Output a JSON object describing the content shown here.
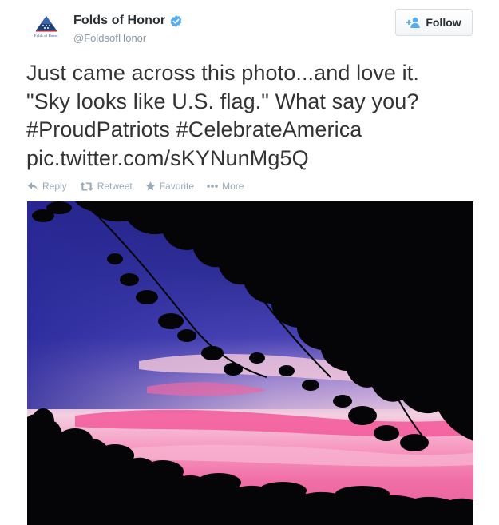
{
  "user": {
    "display_name": "Folds of Honor",
    "handle": "@FoldsofHonor",
    "avatar_text": "Folds of Honor",
    "verified": true
  },
  "follow_button": {
    "label": "Follow",
    "icon": "add-user-icon"
  },
  "tweet": {
    "lines": [
      "Just came across this photo...and love it.",
      "\"Sky looks like U.S. flag.\" What say you?",
      "#ProudPatriots #CelebrateAmerica",
      "pic.twitter.com/sKYNunMg5Q"
    ]
  },
  "actions": [
    {
      "label": "Reply",
      "icon": "reply-icon"
    },
    {
      "label": "Retweet",
      "icon": "retweet-icon"
    },
    {
      "label": "Favorite",
      "icon": "star-icon"
    },
    {
      "label": "More",
      "icon": "more-icon"
    }
  ],
  "colors": {
    "verified": "#55acee",
    "follow_icon": "#55acee",
    "action_text": "#99aab5",
    "sky_blue": "#3a2f9e",
    "sky_pink": "#f07fb0"
  }
}
